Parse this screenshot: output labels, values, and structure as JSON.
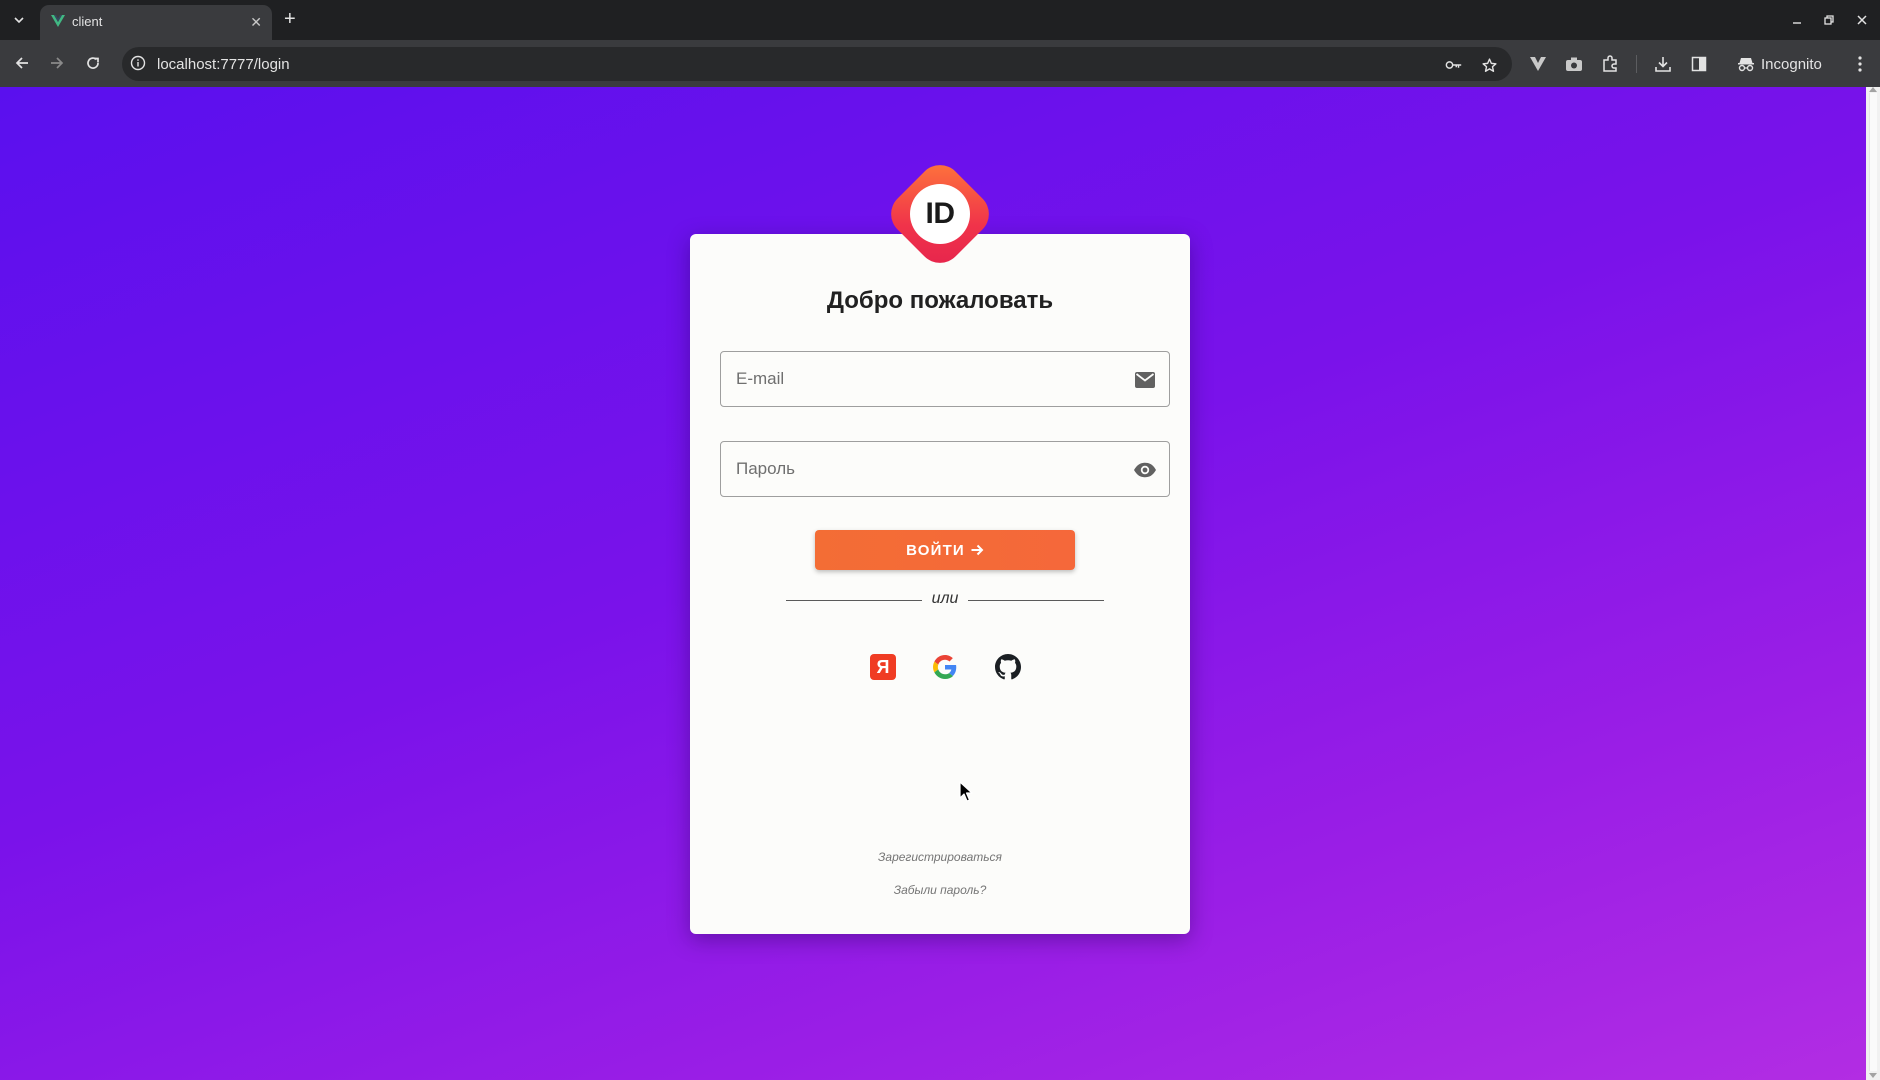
{
  "browser": {
    "tab_title": "client",
    "url": "localhost:7777/login",
    "incognito_label": "Incognito",
    "icons": [
      "tab-list-icon",
      "vue-favicon-icon",
      "close-icon",
      "new-tab-icon",
      "minimize-icon",
      "maximize-icon",
      "window-close-icon",
      "back-icon",
      "forward-icon",
      "reload-icon",
      "site-info-icon",
      "key-icon",
      "star-icon",
      "vuetify-extension-icon",
      "camera-extension-icon",
      "extensions-icon",
      "download-icon",
      "side-panel-icon",
      "incognito-icon",
      "more-menu-icon"
    ]
  },
  "page": {
    "background_gradient": [
      "#5a10ee",
      "#b22de3"
    ],
    "logo_text": "ID",
    "logo_colors": [
      "#ff7a3a",
      "#e5234d"
    ],
    "title": "Добро пожаловать",
    "email": {
      "placeholder": "E-mail",
      "value": "",
      "icon": "mail-icon"
    },
    "password": {
      "placeholder": "Пароль",
      "value": "",
      "icon": "eye-icon"
    },
    "login_button": {
      "label": "ВОЙТИ",
      "icon": "arrow-right-icon",
      "color": "#f36d35"
    },
    "divider_text": "или",
    "social": [
      {
        "name": "yandex",
        "glyph": "Я",
        "color": "#f03c23"
      },
      {
        "name": "google",
        "icon": "google-icon"
      },
      {
        "name": "github",
        "icon": "github-icon"
      }
    ],
    "register_link": "Зарегистрироваться",
    "forgot_link": "Забыли пароль?"
  }
}
